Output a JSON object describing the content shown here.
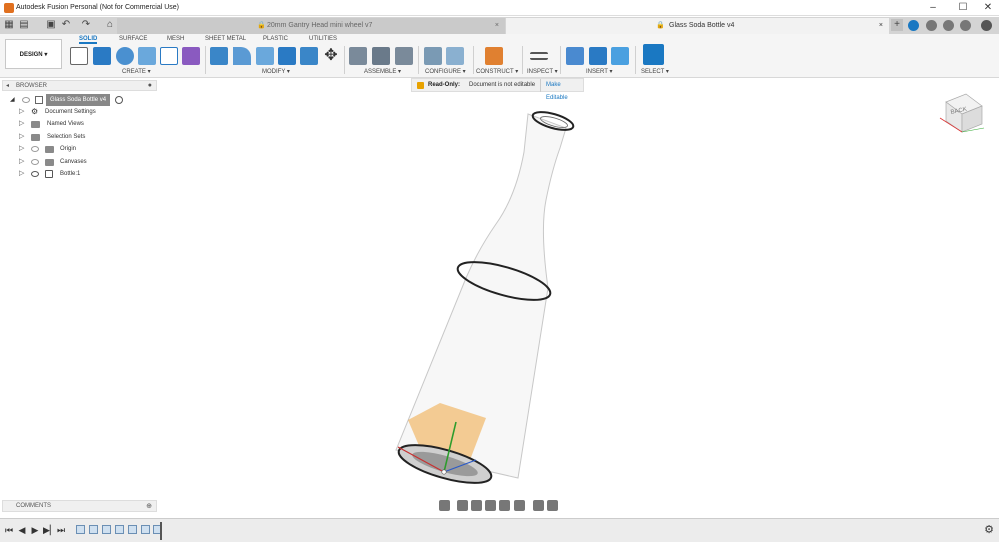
{
  "window": {
    "title": "Autodesk Fusion Personal (Not for Commercial Use)",
    "minimize": "–",
    "maximize": "☐",
    "close": "✕"
  },
  "tabs": [
    {
      "label": "20mm Gantry Head mini wheel v7",
      "active": false
    },
    {
      "label": "Glass Soda Bottle v4",
      "active": true
    }
  ],
  "design_mode": "DESIGN",
  "workspace_tabs": [
    "SOLID",
    "SURFACE",
    "MESH",
    "SHEET METAL",
    "PLASTIC",
    "UTILITIES"
  ],
  "tool_groups": [
    "CREATE",
    "MODIFY",
    "ASSEMBLE",
    "CONFIGURE",
    "CONSTRUCT",
    "INSPECT",
    "INSERT",
    "SELECT"
  ],
  "browser": {
    "title": "BROWSER",
    "root": "Glass Soda Bottle v4",
    "items": [
      "Document Settings",
      "Named Views",
      "Selection Sets",
      "Origin",
      "Canvases",
      "Bottle:1"
    ]
  },
  "readonly": {
    "label": "Read-Only:",
    "message": "Document is not editable",
    "action": "Make Editable"
  },
  "viewcube": {
    "face": "BACK"
  },
  "comments": {
    "title": "COMMENTS"
  },
  "colors": {
    "accent": "#1a78c2",
    "body_highlight": "#f0a030",
    "warning": "#e8a200"
  }
}
